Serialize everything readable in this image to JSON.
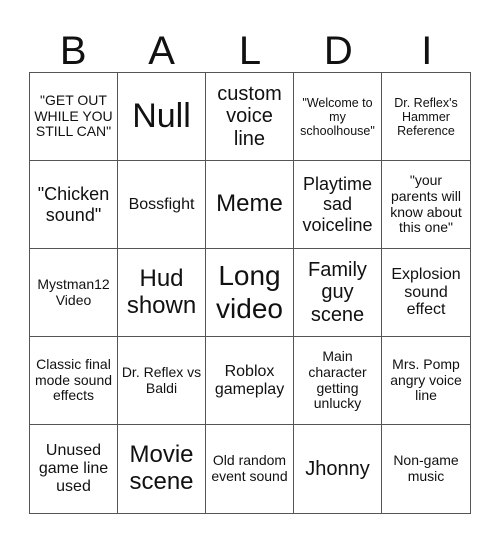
{
  "header": {
    "letters": [
      "B",
      "A",
      "L",
      "D",
      "I"
    ]
  },
  "board": {
    "cells": [
      "\"GET OUT WHILE YOU STILL CAN\"",
      "Null",
      "custom voice line",
      "\"Welcome to my schoolhouse\"",
      "Dr. Reflex's Hammer Reference",
      "\"Chicken sound\"",
      "Bossfight",
      "Meme",
      "Playtime sad voiceline",
      "\"your parents will know about this one\"",
      "Mystman12 Video",
      "Hud shown",
      "Long video",
      "Family guy scene",
      "Explosion sound effect",
      "Classic final mode sound effects",
      "Dr. Reflex vs Baldi",
      "Roblox gameplay",
      "Main character getting unlucky",
      "Mrs. Pomp angry voice line",
      "Unused game line used",
      "Movie scene",
      "Old random event sound",
      "Jhonny",
      "Non-game music"
    ]
  }
}
